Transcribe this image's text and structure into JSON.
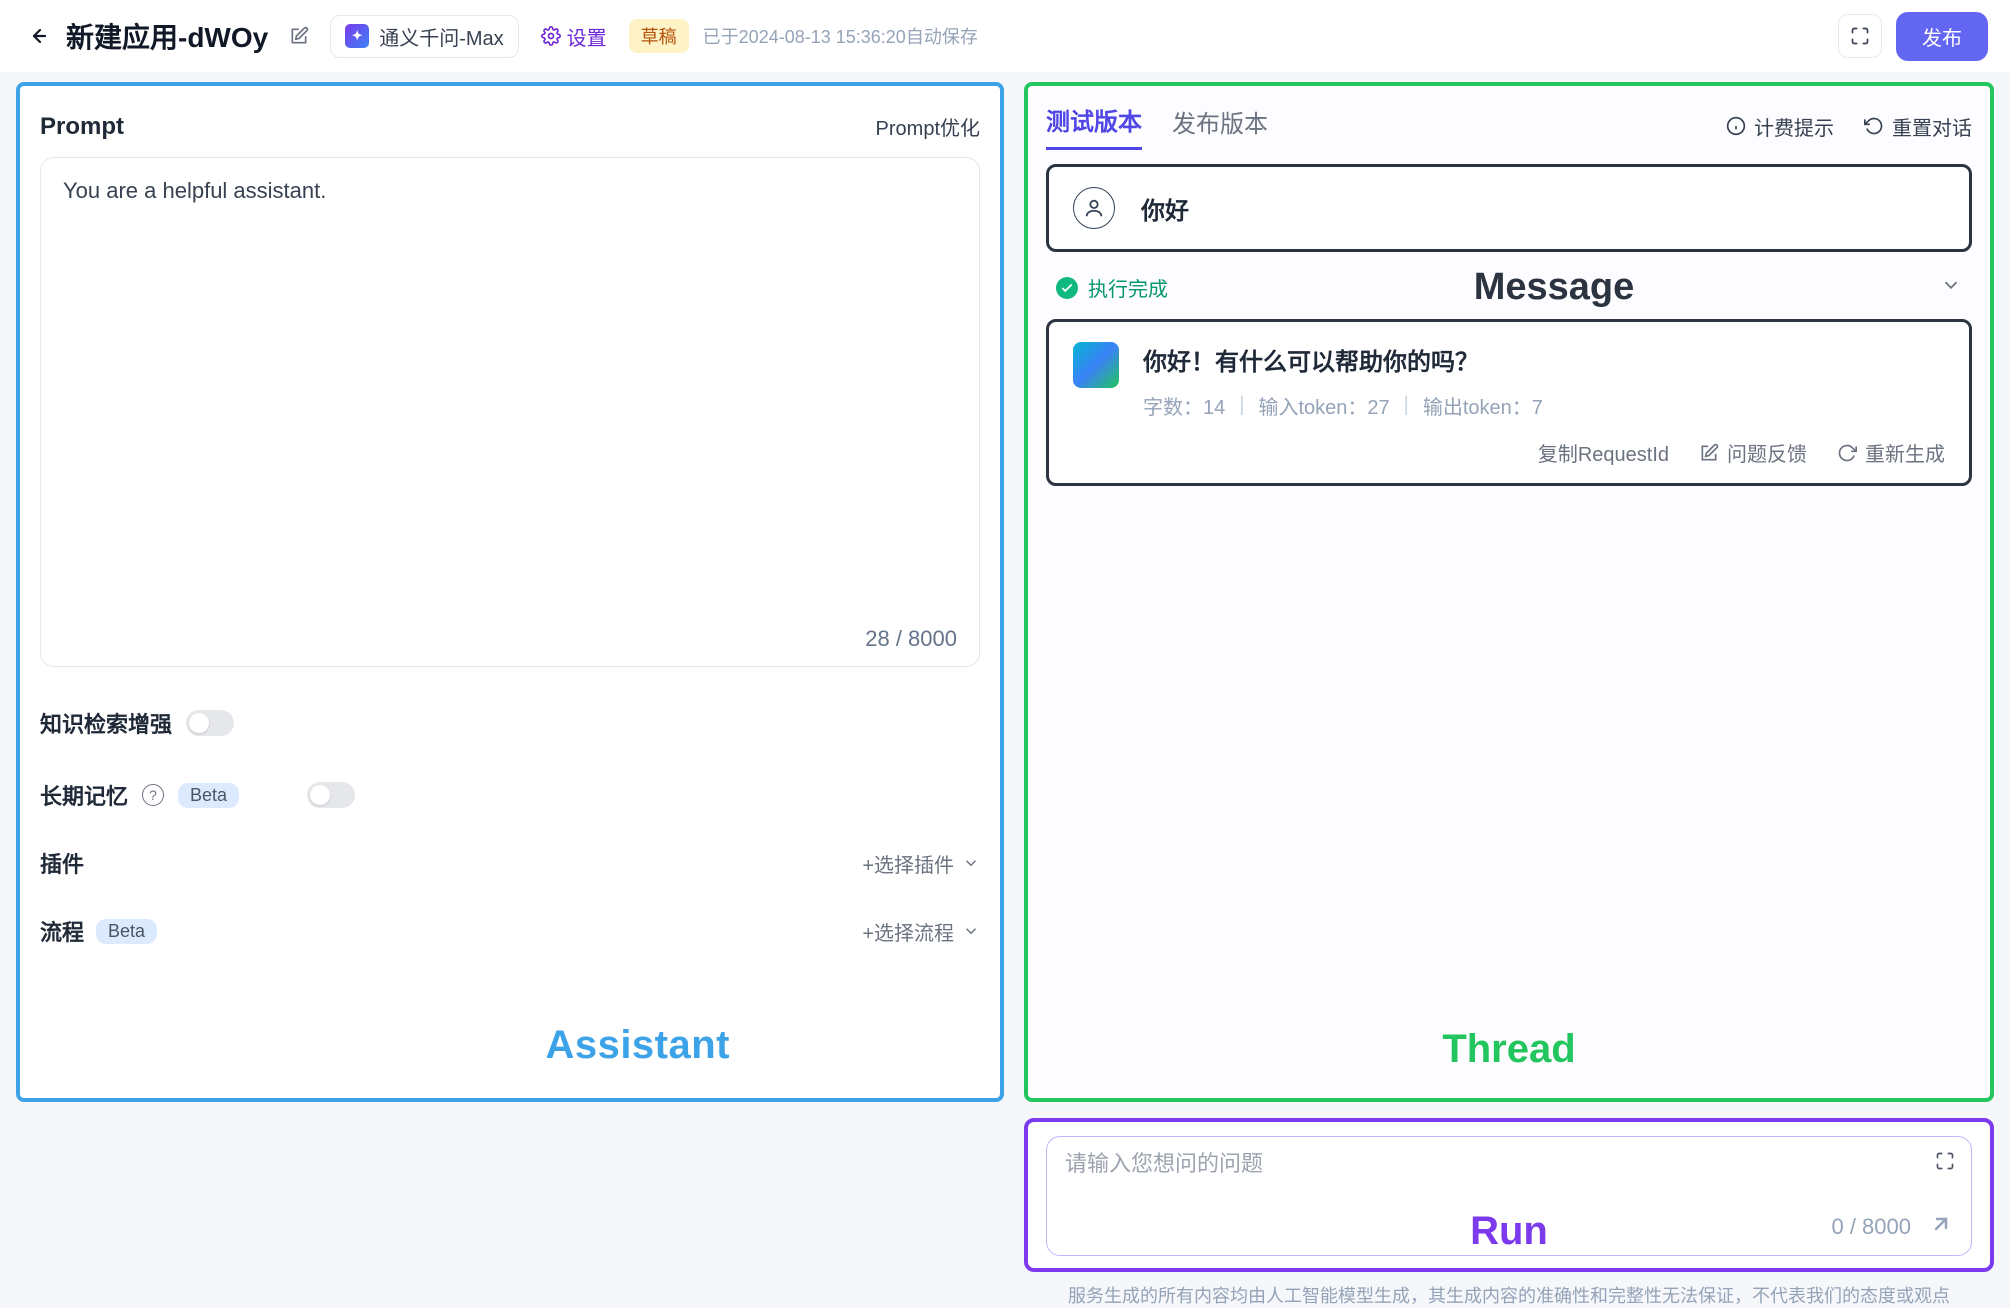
{
  "header": {
    "app_title": "新建应用-dWOy",
    "model_name": "通义千问-Max",
    "settings_label": "设置",
    "draft_badge": "草稿",
    "autosave_text": "已于2024-08-13 15:36:20自动保存",
    "publish_label": "发布"
  },
  "left": {
    "prompt_label": "Prompt",
    "prompt_optimize_label": "Prompt优化",
    "prompt_text": "You are a helpful assistant.",
    "prompt_count": "28",
    "prompt_max": "8000",
    "knowledge_label": "知识检索增强",
    "memory_label": "长期记忆",
    "beta_badge": "Beta",
    "plugin_label": "插件",
    "plugin_select": "+选择插件",
    "process_label": "流程",
    "process_select": "+选择流程",
    "annotation": "Assistant"
  },
  "right": {
    "tabs": {
      "test": "测试版本",
      "release": "发布版本"
    },
    "billing_tip": "计费提示",
    "reset_label": "重置对话",
    "user_message": "你好",
    "status_text": "执行完成",
    "message_annotation": "Message",
    "ai_message": "你好！有什么可以帮助你的吗？",
    "meta": {
      "chars_label": "字数：",
      "chars_value": "14",
      "input_token_label": "输入token：",
      "input_token_value": "27",
      "output_token_label": "输出token：",
      "output_token_value": "7"
    },
    "actions": {
      "copy_request": "复制RequestId",
      "feedback": "问题反馈",
      "regenerate": "重新生成"
    },
    "thread_annotation": "Thread"
  },
  "run": {
    "placeholder": "请输入您想问的问题",
    "count": "0",
    "max": "8000",
    "annotation": "Run"
  },
  "footer": "服务生成的所有内容均由人工智能模型生成，其生成内容的准确性和完整性无法保证，不代表我们的态度或观点"
}
